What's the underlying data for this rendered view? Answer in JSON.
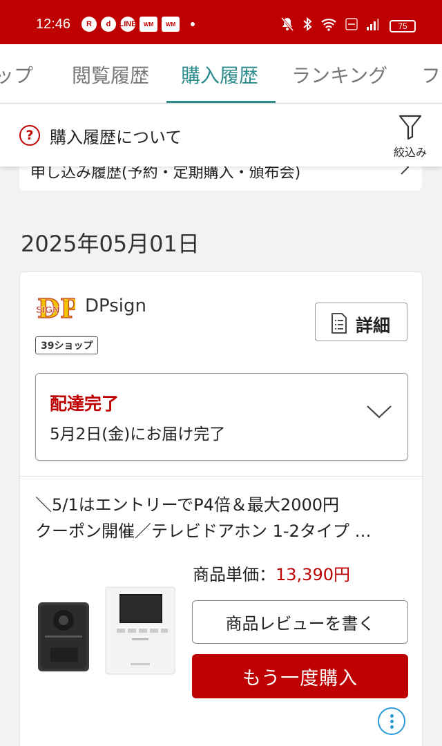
{
  "status_bar": {
    "time": "12:46",
    "apps": [
      "R",
      "d",
      "LINE",
      "WM",
      "WM"
    ],
    "battery": "75"
  },
  "tabs": [
    {
      "label": "ップ"
    },
    {
      "label": "閲覧履歴"
    },
    {
      "label": "購入履歴",
      "active": true
    },
    {
      "label": "ランキング"
    },
    {
      "label": "フ"
    }
  ],
  "info": {
    "label": "購入履歴について",
    "filter_label": "絞込み"
  },
  "reserve": {
    "label": "申し込み履歴(予約・定期購入・頒布会)"
  },
  "date_heading": "2025年05月01日",
  "order": {
    "shop_name": "DPsign",
    "shop_badge": "39ショップ",
    "detail_label": "詳細",
    "delivery_status": "配達完了",
    "delivery_date": "5月2日(金)にお届け完了",
    "product_title_line1": "＼5/1はエントリーでP4倍＆最大2000円",
    "product_title_line2": "クーポン開催／テレビドアホン 1-2タイプ …",
    "price_label": "商品単価：",
    "price_value": "13,390円",
    "review_button": "商品レビューを書く",
    "rebuy_button": "もう一度購入"
  },
  "colors": {
    "brand_red": "#bf0000",
    "tab_active": "#2e8c8c",
    "more_icon": "#2a9ad6"
  }
}
